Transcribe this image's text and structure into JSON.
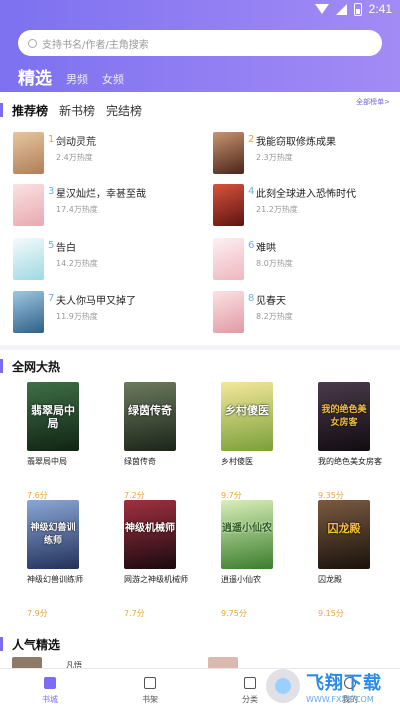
{
  "status": {
    "time": "2:41"
  },
  "search": {
    "placeholder": "支持书名/作者/主角搜索"
  },
  "top_tabs": [
    {
      "label": "精选",
      "active": true
    },
    {
      "label": "男频",
      "active": false
    },
    {
      "label": "女频",
      "active": false
    }
  ],
  "ranking": {
    "tabs": [
      {
        "label": "推荐榜",
        "active": true
      },
      {
        "label": "新书榜",
        "active": false
      },
      {
        "label": "完结榜",
        "active": false
      }
    ],
    "more": "全部榜单>",
    "items": [
      {
        "rank": "1",
        "title": "剑动灵荒",
        "heat": "2.4万热度",
        "cover": "#d9b48a"
      },
      {
        "rank": "2",
        "title": "我能窃取修炼成果",
        "heat": "2.3万热度",
        "cover": "#6e3f2b"
      },
      {
        "rank": "3",
        "title": "星汉灿烂，幸甚至哉",
        "heat": "17.4万热度",
        "cover": "#f2c9cc"
      },
      {
        "rank": "4",
        "title": "此刻全球进入恐怖时代",
        "heat": "21.2万热度",
        "cover": "#b2392a"
      },
      {
        "rank": "5",
        "title": "告白",
        "heat": "14.2万热度",
        "cover": "#bde3ec"
      },
      {
        "rank": "6",
        "title": "难哄",
        "heat": "8.0万热度",
        "cover": "#f6d7dc"
      },
      {
        "rank": "7",
        "title": "夫人你马甲又掉了",
        "heat": "11.9万热度",
        "cover": "#6aa3c6"
      },
      {
        "rank": "8",
        "title": "见春天",
        "heat": "8.2万热度",
        "cover": "#f1c1c7"
      }
    ]
  },
  "hot": {
    "title": "全网大热",
    "books": [
      {
        "name": "翡翠局中局",
        "score": "7.6分",
        "cover_text": "翡翠局中局",
        "cover": "#1f4a2a"
      },
      {
        "name": "绿茵传奇",
        "score": "7.2分",
        "cover_text": "绿茵传奇",
        "cover": "#2e3e2b"
      },
      {
        "name": "乡村傻医",
        "score": "9.7分",
        "cover_text": "乡村傻医",
        "cover": "#b9c45a"
      },
      {
        "name": "我的绝色美女房客",
        "score": "9.35分",
        "cover_text": "我的绝色美女房客",
        "cover": "#2a2230"
      },
      {
        "name": "神级幻兽训练师",
        "score": "7.9分",
        "cover_text": "神级幻兽训练师",
        "cover": "#3b4e7a"
      },
      {
        "name": "网游之神级机械师",
        "score": "7.7分",
        "cover_text": "神级机械师",
        "cover": "#5a1f2a"
      },
      {
        "name": "逍遥小仙农",
        "score": "9.75分",
        "cover_text": "逍遥小仙农",
        "cover": "#4d8f3e"
      },
      {
        "name": "囚龙殿",
        "score": "9.15分",
        "cover_text": "囚龙殿",
        "cover": "#3c2a22"
      }
    ]
  },
  "popular": {
    "title": "人气精选",
    "items": [
      {
        "title": "凡悟",
        "cover": "#8f7a6a"
      },
      {
        "title": "",
        "cover": "#d9b9b0"
      }
    ]
  },
  "bottom_nav": [
    {
      "label": "书城",
      "icon": "bookstore-icon",
      "active": true
    },
    {
      "label": "书架",
      "icon": "bookshelf-icon",
      "active": false
    },
    {
      "label": "分类",
      "icon": "category-icon",
      "active": false
    },
    {
      "label": "我的",
      "icon": "profile-icon",
      "active": false
    }
  ],
  "watermark": {
    "main": "飞翔下载",
    "sub": "WWW.FXXZ.COM"
  },
  "colors": {
    "accent": "#7b6cf0",
    "score": "#f0a43a",
    "header_start": "#7d71f0",
    "header_end": "#a38bf5"
  }
}
